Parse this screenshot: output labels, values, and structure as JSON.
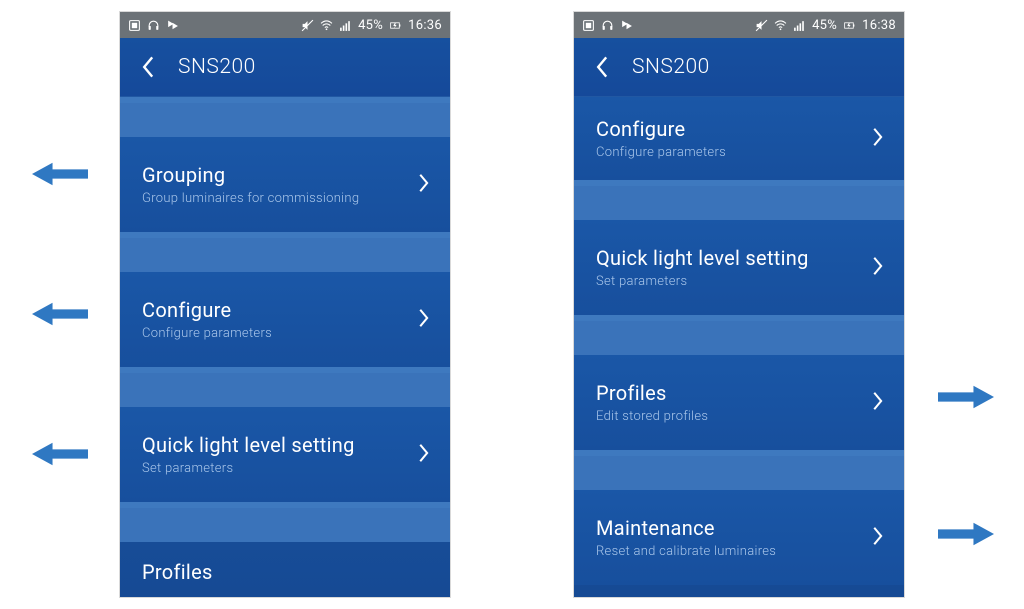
{
  "status": {
    "battery": "45%",
    "time1": "16:36",
    "time2": "16:38"
  },
  "nav": {
    "title": "SNS200"
  },
  "left": {
    "items": [
      {
        "title": "Grouping",
        "sub": "Group luminaires for commissioning"
      },
      {
        "title": "Configure",
        "sub": "Configure parameters"
      },
      {
        "title": "Quick light level setting",
        "sub": "Set parameters"
      }
    ],
    "peek_title": "Profiles"
  },
  "right": {
    "items": [
      {
        "title": "Configure",
        "sub": "Configure parameters"
      },
      {
        "title": "Quick light level setting",
        "sub": "Set parameters"
      },
      {
        "title": "Profiles",
        "sub": "Edit stored profiles"
      },
      {
        "title": "Maintenance",
        "sub": "Reset and calibrate luminaires"
      }
    ]
  },
  "colors": {
    "arrow": "#2f78c2"
  }
}
